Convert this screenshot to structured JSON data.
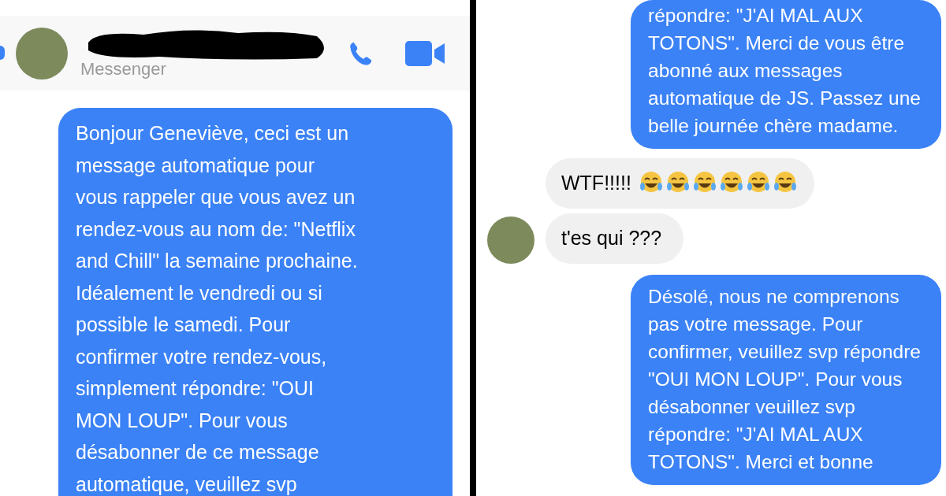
{
  "left_chat": {
    "header": {
      "subtitle": "Messenger"
    },
    "messages": [
      {
        "kind": "sent",
        "text": "Bonjour Geneviève, ceci est un\nmessage automatique pour\nvous rappeler que vous avez un\nrendez-vous au nom de: \"Netflix\nand Chill\" la semaine prochaine.\nIdéalement le vendredi ou si\npossible le samedi. Pour\nconfirmer votre rendez-vous,\nsimplement répondre: \"OUI\nMON LOUP\". Pour vous\ndésabonner de ce message\nautomatique, veuillez svp"
      }
    ]
  },
  "right_chat": {
    "messages": [
      {
        "kind": "sent",
        "text": "répondre: \"J'AI MAL AUX\nTOTONS\". Merci de vous être\nabonné aux messages\nautomatique de JS. Passez une\nbelle journée chère madame."
      },
      {
        "kind": "received",
        "text": "WTF!!!!!",
        "with_emoji": true,
        "avatar": false
      },
      {
        "kind": "received",
        "text": "t'es qui ???",
        "with_emoji": false,
        "avatar": true
      },
      {
        "kind": "sent",
        "text": "Désolé, nous ne comprenons\npas votre message. Pour\nconfirmer, veuillez svp répondre\n\"OUI MON LOUP\". Pour vous\ndésabonner veuillez svp\nrépondre: \"J'AI MAL AUX\nTOTONS\". Merci et bonne"
      }
    ]
  }
}
